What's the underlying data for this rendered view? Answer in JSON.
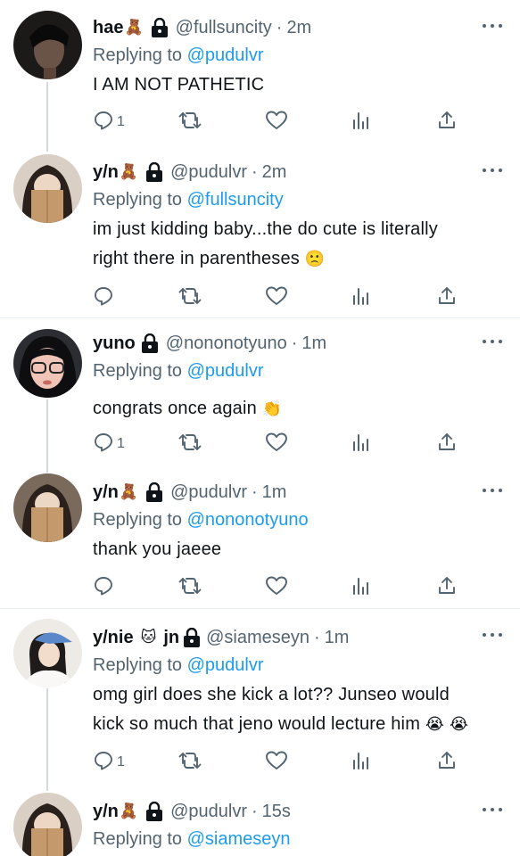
{
  "tweets": [
    {
      "name": "hae",
      "name_emoji": "🧸",
      "extra": "",
      "handle": "@fullsuncity",
      "time": "2m",
      "reply_prefix": "Replying to",
      "reply_to": "@pudulvr",
      "lines": [
        "I AM NOT PATHETIC"
      ],
      "line_emoji": [
        "",
        ""
      ],
      "reply_count": "1"
    },
    {
      "name": "y/n",
      "name_emoji": "🧸",
      "extra": "",
      "handle": "@pudulvr",
      "time": "2m",
      "reply_prefix": "Replying to",
      "reply_to": "@fullsuncity",
      "lines": [
        "im just kidding baby...the do cute is literally",
        "right there in parentheses"
      ],
      "line_emoji": [
        "",
        "🙁"
      ],
      "reply_count": ""
    },
    {
      "name": "yuno",
      "name_emoji": "",
      "extra": "",
      "handle": "@nononotyuno",
      "time": "1m",
      "reply_prefix": "Replying to",
      "reply_to": "@pudulvr",
      "lines": [
        "congrats once again"
      ],
      "line_emoji": [
        "👏"
      ],
      "reply_count": "1"
    },
    {
      "name": "y/n",
      "name_emoji": "🧸",
      "extra": "",
      "handle": "@pudulvr",
      "time": "1m",
      "reply_prefix": "Replying to",
      "reply_to": "@nononotyuno",
      "lines": [
        "thank you jaeee"
      ],
      "line_emoji": [
        ""
      ],
      "reply_count": ""
    },
    {
      "name": "y/nie",
      "name_emoji": "🐱",
      "extra": "jn",
      "handle": "@siameseyn",
      "time": "1m",
      "reply_prefix": "Replying to",
      "reply_to": "@pudulvr",
      "lines": [
        "omg girl does she kick a lot?? Junseo would",
        "kick so much that jeno would lecture him"
      ],
      "line_emoji": [
        "",
        "😭 😭"
      ],
      "reply_count": "1"
    },
    {
      "name": "y/n",
      "name_emoji": "🧸",
      "extra": "",
      "handle": "@pudulvr",
      "time": "15s",
      "reply_prefix": "Replying to",
      "reply_to": "@siameseyn",
      "lines": [],
      "line_emoji": [],
      "reply_count": ""
    }
  ],
  "icons": {
    "reply": "reply-icon",
    "retweet": "retweet-icon",
    "like": "heart-icon",
    "stats": "stats-icon",
    "share": "share-icon",
    "more": "more-icon",
    "lock": "lock-icon"
  },
  "colors": {
    "link": "#1d9bf0",
    "muted": "#536471",
    "text": "#0f1419",
    "line": "#cfd9de"
  }
}
